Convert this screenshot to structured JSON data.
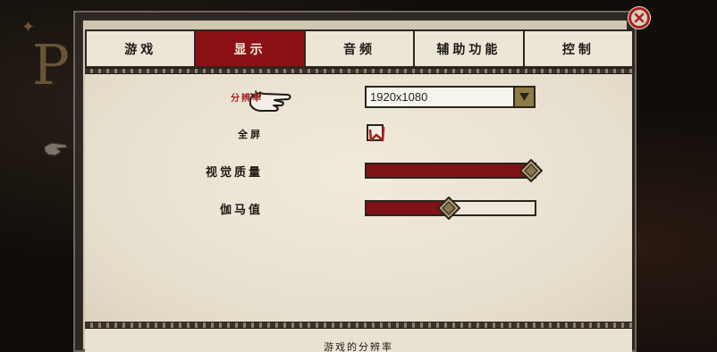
{
  "background": {
    "title_letter": "P"
  },
  "tabs": [
    {
      "label": "游戏",
      "active": false
    },
    {
      "label": "显示",
      "active": true
    },
    {
      "label": "音频",
      "active": false
    },
    {
      "label": "辅助功能",
      "active": false
    },
    {
      "label": "控制",
      "active": false
    }
  ],
  "display": {
    "resolution": {
      "label": "分辨率",
      "value": "1920x1080"
    },
    "fullscreen": {
      "label": "全屏",
      "checked": true
    },
    "visual_quality": {
      "label": "视觉质量",
      "level": 0.98
    },
    "gamma": {
      "label": "伽马值",
      "level": 0.49
    }
  },
  "footer": {
    "description": "游戏的分辨率"
  },
  "colors": {
    "accent": "#8a1215",
    "parchment": "#ece6d7",
    "frame": "#2d2823"
  },
  "icons": {
    "close": "close-icon",
    "pointer": "pointing-hand-icon",
    "dropdown": "chevron-down-icon",
    "check": "checkmark-icon",
    "knob": "diamond-knob-icon"
  }
}
